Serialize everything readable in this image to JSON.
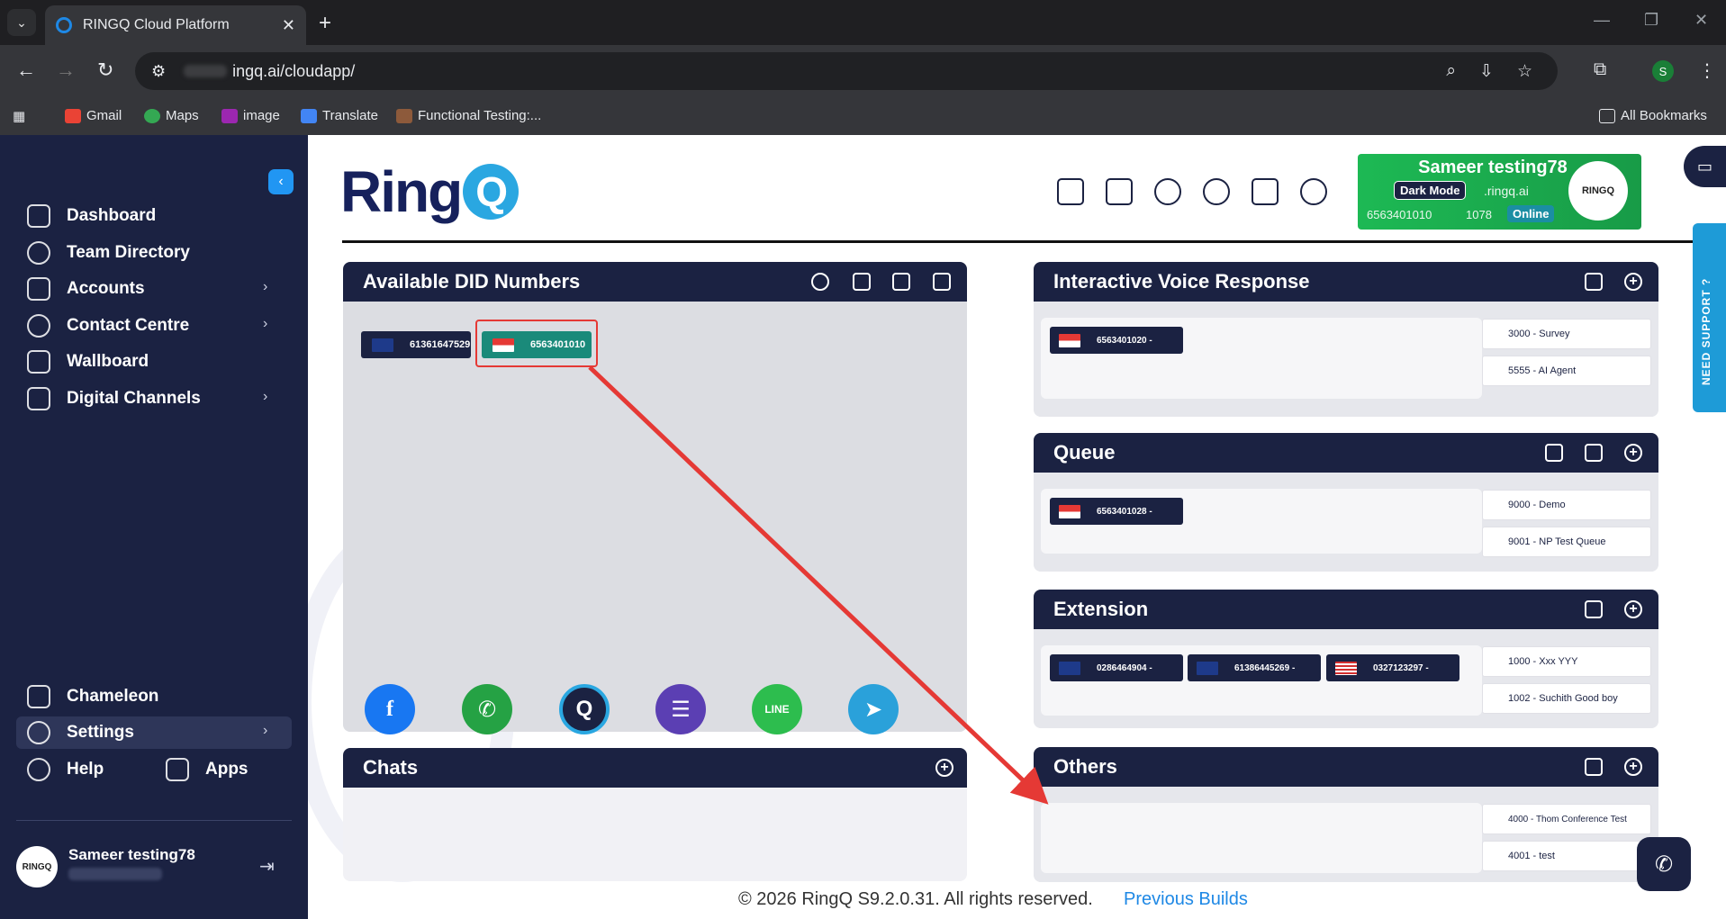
{
  "browser": {
    "tab_title": "RINGQ Cloud Platform",
    "url": "ingq.ai/cloudapp/",
    "bookmarks": [
      "Gmail",
      "Maps",
      "image",
      "Translate",
      "Functional Testing:..."
    ],
    "all_bookmarks": "All Bookmarks",
    "profile_initial": "S"
  },
  "sidebar": {
    "items": [
      {
        "label": "Dashboard",
        "icon": "home-icon"
      },
      {
        "label": "Team Directory",
        "icon": "user-icon"
      },
      {
        "label": "Accounts",
        "icon": "account-icon"
      },
      {
        "label": "Contact Centre",
        "icon": "phone-icon"
      },
      {
        "label": "Wallboard",
        "icon": "wallboard-icon"
      },
      {
        "label": "Digital Channels",
        "icon": "chat-icon"
      }
    ],
    "bottom_items": [
      {
        "label": "Chameleon",
        "icon": "clipboard-icon"
      },
      {
        "label": "Settings",
        "icon": "gear-icon"
      },
      {
        "label": "Help",
        "icon": "help-icon"
      },
      {
        "label": "Apps",
        "icon": "apps-icon"
      }
    ],
    "user_name": "Sameer testing78",
    "avatar_text": "RINGQ"
  },
  "header": {
    "logo": "RingQ",
    "profile": {
      "name": "Sameer testing78",
      "dark_mode": "Dark Mode",
      "domain": ".ringq.ai",
      "number": "6563401010",
      "extension": "1078",
      "status": "Online",
      "avatar_text": "RINGQ"
    }
  },
  "did_panel": {
    "title": "Available DID Numbers",
    "numbers": [
      {
        "number": "61361647529",
        "flag": "au"
      },
      {
        "number": "6563401010",
        "flag": "sg"
      }
    ]
  },
  "ivr_panel": {
    "title": "Interactive Voice Response",
    "assigned": [
      "6563401020 -"
    ],
    "items": [
      "3000 - Survey",
      "5555 - AI Agent"
    ]
  },
  "queue_panel": {
    "title": "Queue",
    "assigned": [
      "6563401028 -"
    ],
    "items": [
      "9000 - Demo",
      "9001 - NP Test Queue"
    ]
  },
  "extension_panel": {
    "title": "Extension",
    "assigned": [
      "0286464904 -",
      "61386445269 -",
      "0327123297 -"
    ],
    "items": [
      "1000 - Xxx YYY",
      "1002 - Suchith Good boy"
    ]
  },
  "others_panel": {
    "title": "Others",
    "items": [
      "4000 - Thom Conference Test",
      "4001 - test"
    ]
  },
  "chats_panel": {
    "title": "Chats",
    "channels": [
      {
        "name": "facebook-icon",
        "glyph": "f",
        "color": "#1877f2"
      },
      {
        "name": "whatsapp-icon",
        "glyph": "✆",
        "color": "#25a244"
      },
      {
        "name": "ringq-chat-icon",
        "glyph": "Q",
        "color": "#1b2242"
      },
      {
        "name": "sms-icon",
        "glyph": "☰",
        "color": "#5b3fb3"
      },
      {
        "name": "line-icon",
        "glyph": "LINE",
        "color": "#2dbd4e"
      },
      {
        "name": "telegram-icon",
        "glyph": "➤",
        "color": "#2aa1da"
      }
    ]
  },
  "footer": {
    "copyright": "© 2026 RingQ S9.2.0.31. All rights reserved.",
    "previous_builds": "Previous Builds"
  },
  "need_support": "NEED SUPPORT ?",
  "colors": {
    "navy": "#1b2242",
    "accent": "#2196f3",
    "online": "#1db954",
    "highlight": "#e53935"
  }
}
